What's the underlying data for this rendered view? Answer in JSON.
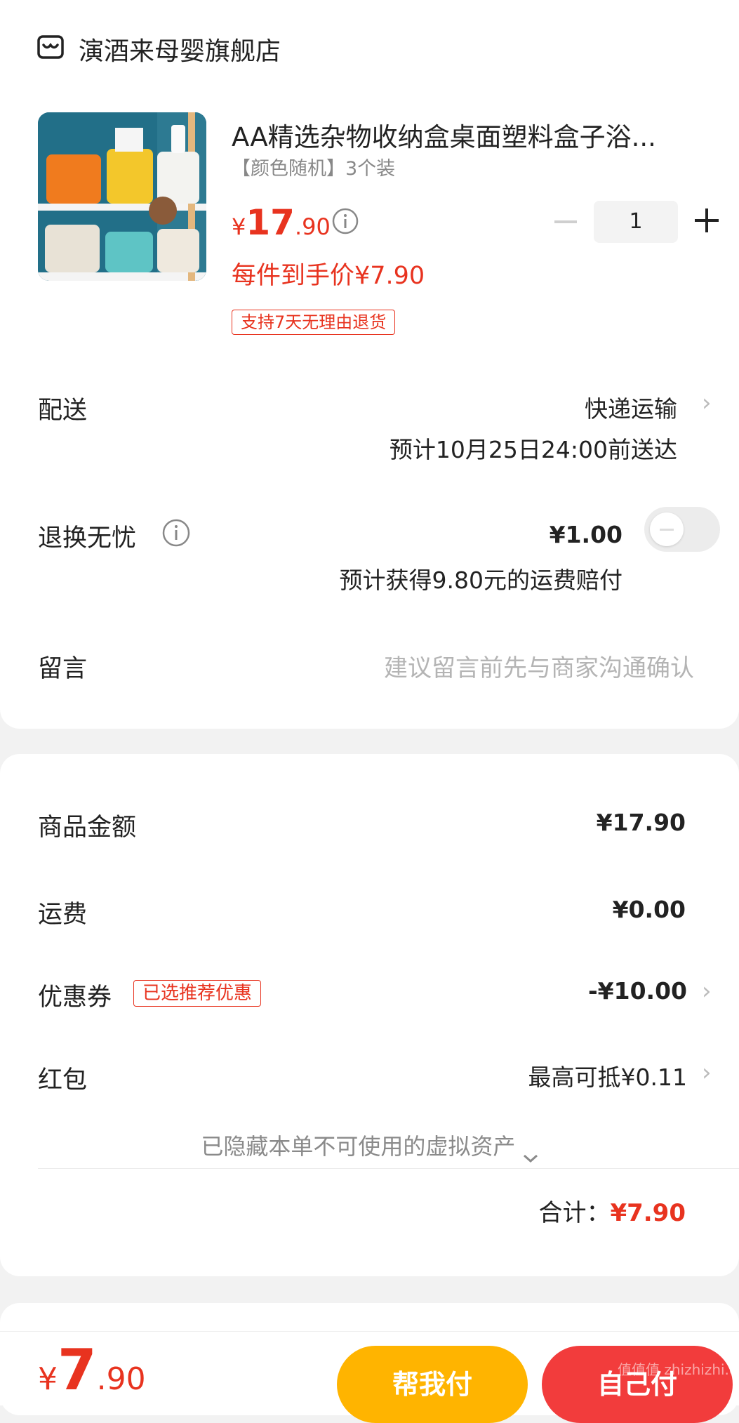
{
  "store": {
    "name": "演酒来母婴旗舰店",
    "icon": "store-icon"
  },
  "product": {
    "title": "AA精选杂物收纳盒桌面塑料盒子浴...",
    "spec": "【颜色随机】3个装",
    "price_symbol": "¥",
    "price_int": "17",
    "price_dec": ".90",
    "unit_price": "每件到手价¥7.90",
    "quantity": "1",
    "return_tag": "支持7天无理由退货"
  },
  "delivery": {
    "label": "配送",
    "method": "快递运输",
    "eta": "预计10月25日24:00前送达"
  },
  "worry_free": {
    "label": "退换无忧",
    "price": "¥1.00",
    "note": "预计获得9.80元的运费赔付",
    "enabled": false
  },
  "message": {
    "label": "留言",
    "placeholder": "建议留言前先与商家沟通确认"
  },
  "summary": {
    "goods_label": "商品金额",
    "goods_value": "¥17.90",
    "shipping_label": "运费",
    "shipping_value": "¥0.00",
    "coupon_label": "优惠券",
    "coupon_tag": "已选推荐优惠",
    "coupon_value": "-¥10.00",
    "redpacket_label": "红包",
    "redpacket_value": "最高可抵¥0.11",
    "hidden_note": "已隐藏本单不可使用的虚拟资产",
    "total_label": "合计：",
    "total_value": "¥7.90"
  },
  "footer": {
    "price_symbol": "¥",
    "price_int": "7",
    "price_dec": ".90",
    "help_pay": "帮我付",
    "self_pay": "自己付"
  },
  "watermark": "值值值 zhizhizhi.com",
  "colors": {
    "accent": "#e8331f",
    "help_pay_bg": "#ffb400",
    "self_pay_bg": "#f23c3c"
  }
}
